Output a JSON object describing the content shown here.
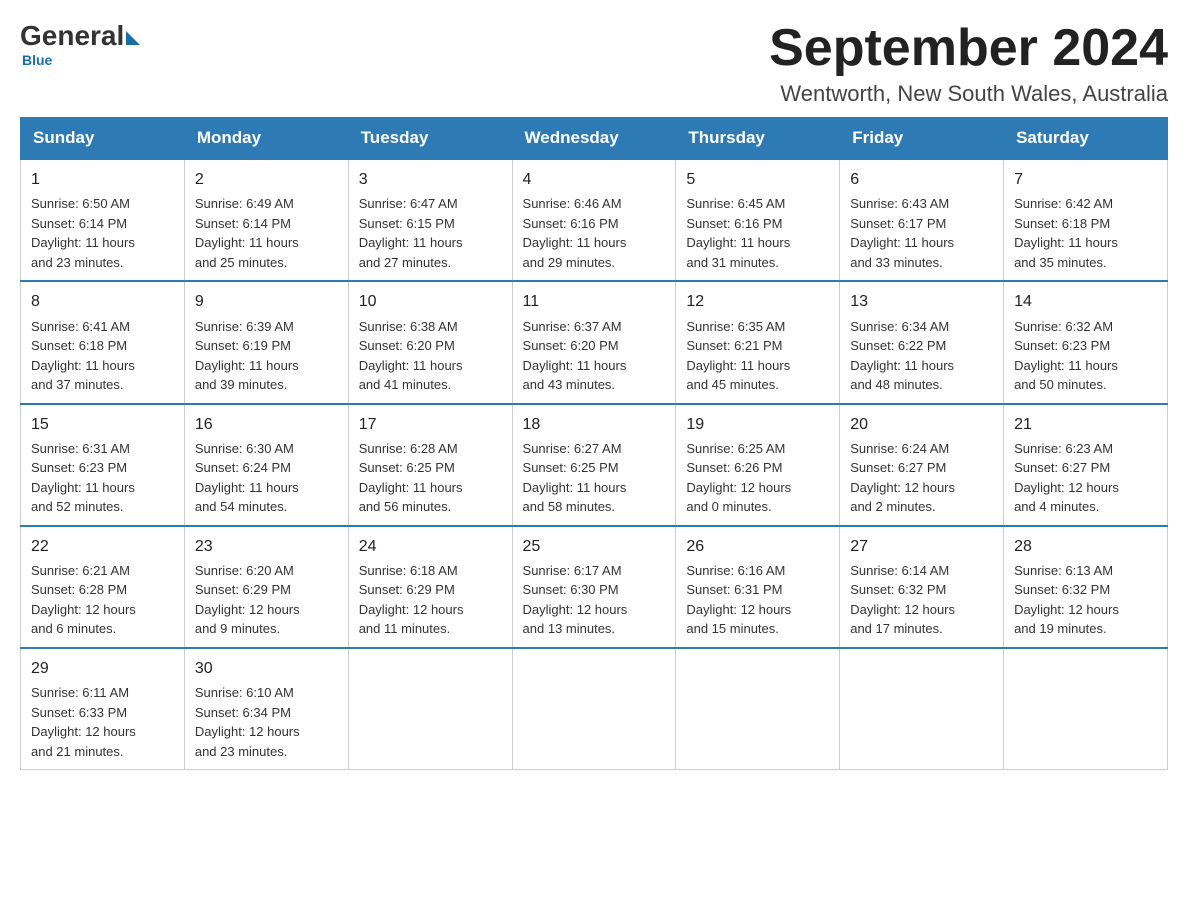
{
  "logo": {
    "general": "General",
    "blue": "Blue",
    "subtitle": "Blue"
  },
  "title": "September 2024",
  "location": "Wentworth, New South Wales, Australia",
  "days_of_week": [
    "Sunday",
    "Monday",
    "Tuesday",
    "Wednesday",
    "Thursday",
    "Friday",
    "Saturday"
  ],
  "weeks": [
    [
      {
        "day": "1",
        "sunrise": "6:50 AM",
        "sunset": "6:14 PM",
        "daylight": "11 hours and 23 minutes."
      },
      {
        "day": "2",
        "sunrise": "6:49 AM",
        "sunset": "6:14 PM",
        "daylight": "11 hours and 25 minutes."
      },
      {
        "day": "3",
        "sunrise": "6:47 AM",
        "sunset": "6:15 PM",
        "daylight": "11 hours and 27 minutes."
      },
      {
        "day": "4",
        "sunrise": "6:46 AM",
        "sunset": "6:16 PM",
        "daylight": "11 hours and 29 minutes."
      },
      {
        "day": "5",
        "sunrise": "6:45 AM",
        "sunset": "6:16 PM",
        "daylight": "11 hours and 31 minutes."
      },
      {
        "day": "6",
        "sunrise": "6:43 AM",
        "sunset": "6:17 PM",
        "daylight": "11 hours and 33 minutes."
      },
      {
        "day": "7",
        "sunrise": "6:42 AM",
        "sunset": "6:18 PM",
        "daylight": "11 hours and 35 minutes."
      }
    ],
    [
      {
        "day": "8",
        "sunrise": "6:41 AM",
        "sunset": "6:18 PM",
        "daylight": "11 hours and 37 minutes."
      },
      {
        "day": "9",
        "sunrise": "6:39 AM",
        "sunset": "6:19 PM",
        "daylight": "11 hours and 39 minutes."
      },
      {
        "day": "10",
        "sunrise": "6:38 AM",
        "sunset": "6:20 PM",
        "daylight": "11 hours and 41 minutes."
      },
      {
        "day": "11",
        "sunrise": "6:37 AM",
        "sunset": "6:20 PM",
        "daylight": "11 hours and 43 minutes."
      },
      {
        "day": "12",
        "sunrise": "6:35 AM",
        "sunset": "6:21 PM",
        "daylight": "11 hours and 45 minutes."
      },
      {
        "day": "13",
        "sunrise": "6:34 AM",
        "sunset": "6:22 PM",
        "daylight": "11 hours and 48 minutes."
      },
      {
        "day": "14",
        "sunrise": "6:32 AM",
        "sunset": "6:23 PM",
        "daylight": "11 hours and 50 minutes."
      }
    ],
    [
      {
        "day": "15",
        "sunrise": "6:31 AM",
        "sunset": "6:23 PM",
        "daylight": "11 hours and 52 minutes."
      },
      {
        "day": "16",
        "sunrise": "6:30 AM",
        "sunset": "6:24 PM",
        "daylight": "11 hours and 54 minutes."
      },
      {
        "day": "17",
        "sunrise": "6:28 AM",
        "sunset": "6:25 PM",
        "daylight": "11 hours and 56 minutes."
      },
      {
        "day": "18",
        "sunrise": "6:27 AM",
        "sunset": "6:25 PM",
        "daylight": "11 hours and 58 minutes."
      },
      {
        "day": "19",
        "sunrise": "6:25 AM",
        "sunset": "6:26 PM",
        "daylight": "12 hours and 0 minutes."
      },
      {
        "day": "20",
        "sunrise": "6:24 AM",
        "sunset": "6:27 PM",
        "daylight": "12 hours and 2 minutes."
      },
      {
        "day": "21",
        "sunrise": "6:23 AM",
        "sunset": "6:27 PM",
        "daylight": "12 hours and 4 minutes."
      }
    ],
    [
      {
        "day": "22",
        "sunrise": "6:21 AM",
        "sunset": "6:28 PM",
        "daylight": "12 hours and 6 minutes."
      },
      {
        "day": "23",
        "sunrise": "6:20 AM",
        "sunset": "6:29 PM",
        "daylight": "12 hours and 9 minutes."
      },
      {
        "day": "24",
        "sunrise": "6:18 AM",
        "sunset": "6:29 PM",
        "daylight": "12 hours and 11 minutes."
      },
      {
        "day": "25",
        "sunrise": "6:17 AM",
        "sunset": "6:30 PM",
        "daylight": "12 hours and 13 minutes."
      },
      {
        "day": "26",
        "sunrise": "6:16 AM",
        "sunset": "6:31 PM",
        "daylight": "12 hours and 15 minutes."
      },
      {
        "day": "27",
        "sunrise": "6:14 AM",
        "sunset": "6:32 PM",
        "daylight": "12 hours and 17 minutes."
      },
      {
        "day": "28",
        "sunrise": "6:13 AM",
        "sunset": "6:32 PM",
        "daylight": "12 hours and 19 minutes."
      }
    ],
    [
      {
        "day": "29",
        "sunrise": "6:11 AM",
        "sunset": "6:33 PM",
        "daylight": "12 hours and 21 minutes."
      },
      {
        "day": "30",
        "sunrise": "6:10 AM",
        "sunset": "6:34 PM",
        "daylight": "12 hours and 23 minutes."
      },
      null,
      null,
      null,
      null,
      null
    ]
  ],
  "labels": {
    "sunrise": "Sunrise:",
    "sunset": "Sunset:",
    "daylight": "Daylight:"
  }
}
